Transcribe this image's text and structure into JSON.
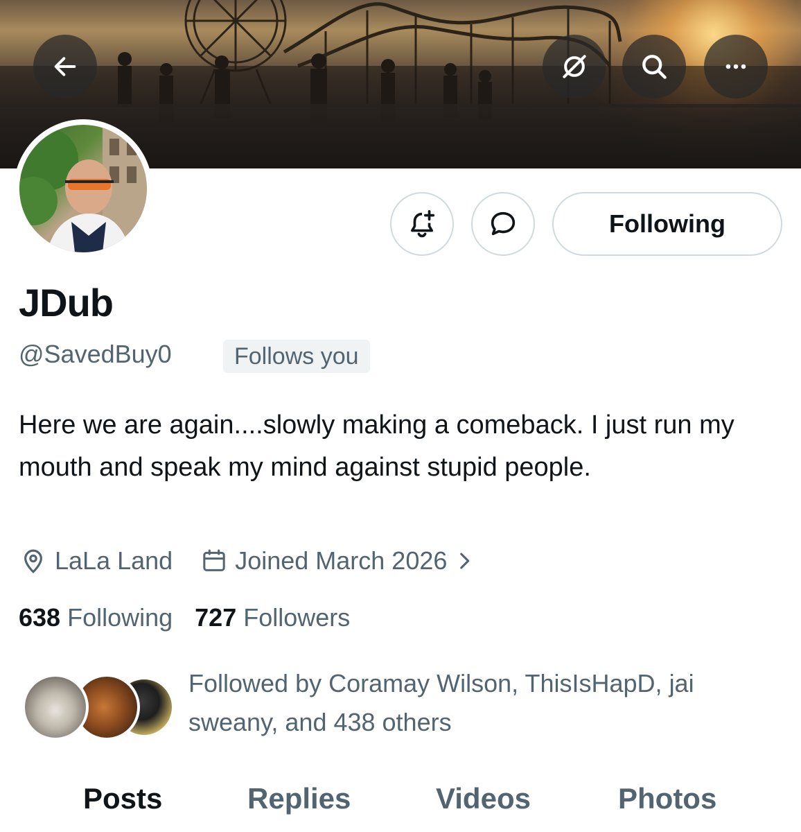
{
  "header": {
    "back_icon": "arrow-left-icon",
    "translate_icon": "grok-translate-icon",
    "search_icon": "search-icon",
    "more_icon": "more-horizontal-icon"
  },
  "actions": {
    "notify_icon": "bell-plus-icon",
    "message_icon": "message-bubble-icon",
    "following_label": "Following"
  },
  "profile": {
    "name": "JDub",
    "handle": "@SavedBuy0",
    "follows_you": "Follows you",
    "bio": "Here we are again....slowly making a comeback. I just run my mouth and speak my mind against stupid people.",
    "location": "LaLa Land",
    "joined": "Joined March 2026"
  },
  "stats": {
    "following_count": "638",
    "following_label": "Following",
    "followers_count": "727",
    "followers_label": "Followers"
  },
  "mutuals": {
    "text": "Followed by Coramay Wilson, ThisIsHapD, jai sweany, and 438 others"
  },
  "tabs": [
    "Posts",
    "Replies",
    "Videos",
    "Photos"
  ],
  "colors": {
    "primary_text": "#0f1419",
    "secondary_text": "#536471",
    "border": "#cfd9de",
    "badge_bg": "#eff3f4"
  }
}
